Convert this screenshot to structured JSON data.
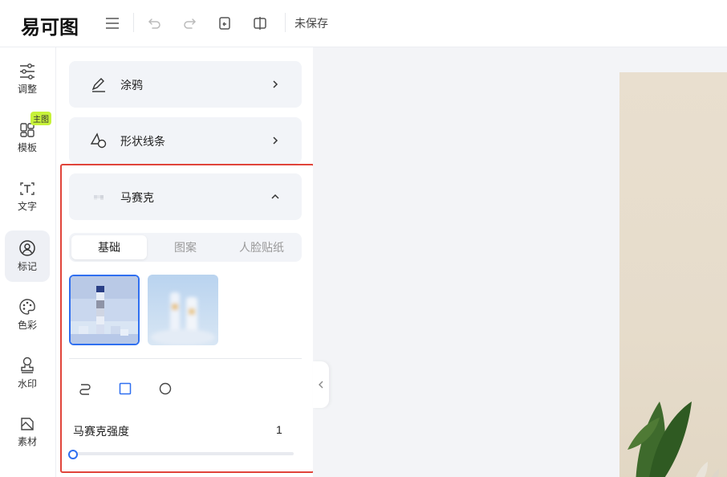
{
  "app": {
    "logo": "易可图",
    "save_status": "未保存"
  },
  "toolbar": {
    "icons": [
      "menu-icon",
      "undo-icon",
      "redo-icon",
      "restore-icon",
      "compare-icon"
    ]
  },
  "rail": {
    "items": [
      {
        "label": "调整",
        "icon": "sliders-icon"
      },
      {
        "label": "模板",
        "icon": "template-icon"
      },
      {
        "label": "文字",
        "icon": "text-icon"
      },
      {
        "label": "标记",
        "icon": "mark-icon"
      },
      {
        "label": "色彩",
        "icon": "palette-icon"
      },
      {
        "label": "水印",
        "icon": "stamp-icon"
      },
      {
        "label": "素材",
        "icon": "material-icon"
      }
    ],
    "badge": "主图",
    "active": "标记"
  },
  "panel": {
    "cards": [
      {
        "title": "涂鸦",
        "icon": "brush-icon",
        "expanded": false
      },
      {
        "title": "形状线条",
        "icon": "shapes-icon",
        "expanded": false
      },
      {
        "title": "马赛克",
        "icon": "mosaic-icon",
        "expanded": true
      }
    ],
    "tabs": [
      {
        "label": "基础",
        "active": true
      },
      {
        "label": "图案",
        "active": false
      },
      {
        "label": "人脸贴纸",
        "active": false
      }
    ],
    "brush_shapes": [
      "freehand-icon",
      "rectangle-icon",
      "circle-icon"
    ],
    "strength": {
      "label": "马赛克强度",
      "value": 1,
      "min": 1,
      "max": 100
    }
  },
  "colors": {
    "accent": "#2f6ff0",
    "highlight": "#e0443a",
    "badge": "#c7f23a"
  }
}
